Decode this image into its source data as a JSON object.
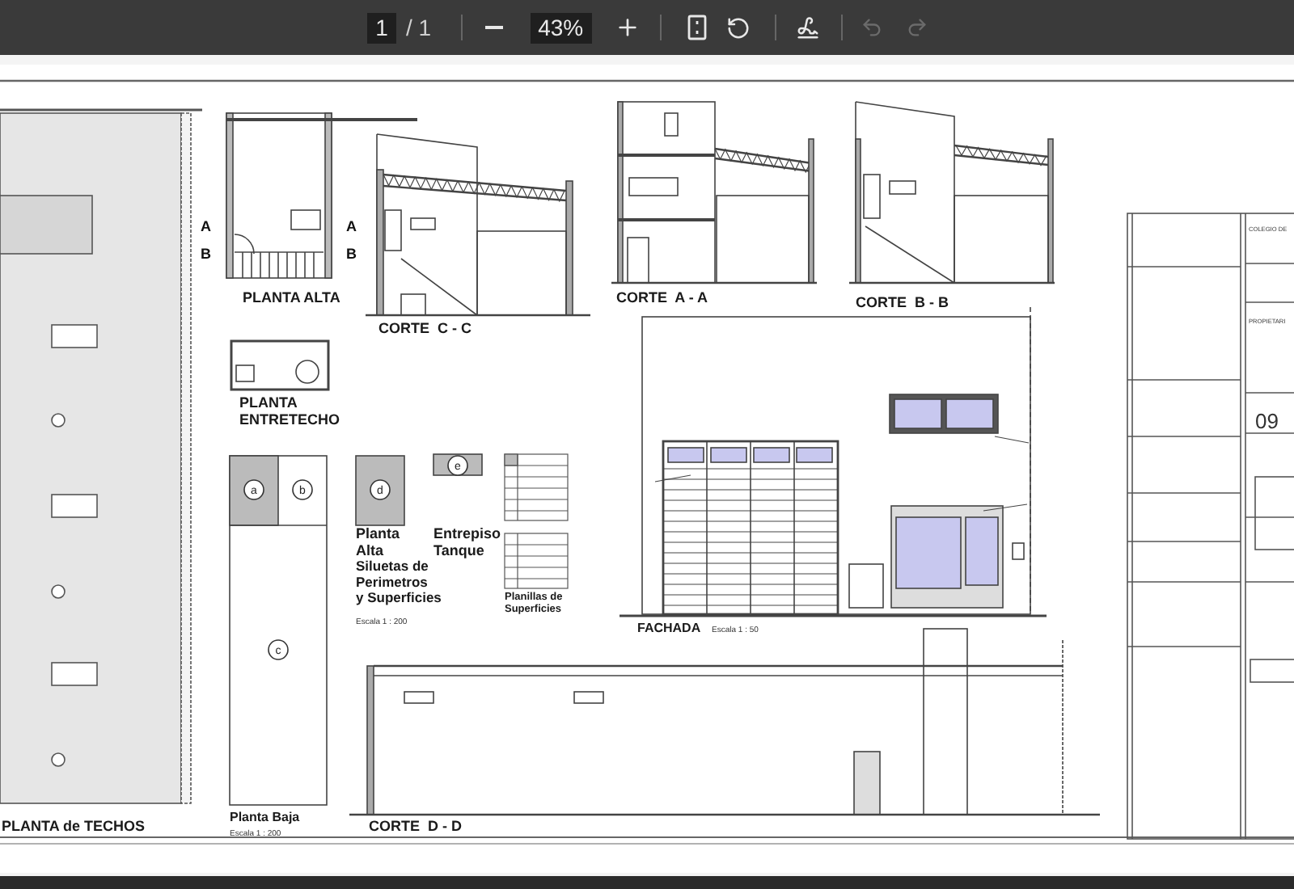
{
  "toolbar": {
    "page": "1",
    "page_total": "/ 1",
    "zoom": "43%",
    "undo_disabled": true,
    "redo_disabled": true
  },
  "views": [
    {
      "lines": [
        "PLANTA de TECHOS"
      ]
    },
    {
      "lines": [
        "PLANTA ALTA"
      ]
    },
    {
      "lines": [
        "PLANTA",
        "ENTRETECHO"
      ]
    },
    {
      "lines": [
        "CORTE  C - C"
      ]
    },
    {
      "lines": [
        "CORTE  A - A"
      ]
    },
    {
      "lines": [
        "CORTE  B - B"
      ]
    },
    {
      "lines": [
        "FACHADA"
      ],
      "scale": "Escala 1 : 50"
    },
    {
      "lines": [
        "Planta Baja"
      ],
      "scale": "Escala 1 : 200"
    },
    {
      "lines": [
        "CORTE  D - D"
      ]
    },
    {
      "lines": [
        "Planta",
        "Alta"
      ]
    },
    {
      "lines": [
        "Entrepiso",
        "Tanque"
      ]
    },
    {
      "lines": [
        "Siluetas de",
        "Perimetros",
        "y Superficies"
      ],
      "scale": "Escala 1 : 200"
    },
    {
      "lines": [
        "Planillas de",
        "Superficies"
      ]
    }
  ],
  "section_markers": [
    "A",
    "A",
    "B",
    "B"
  ],
  "areas": [
    "a",
    "b",
    "c",
    "d",
    "e"
  ],
  "title_block": [
    "COLEGIO DE",
    "PROPIETARI",
    "09"
  ]
}
